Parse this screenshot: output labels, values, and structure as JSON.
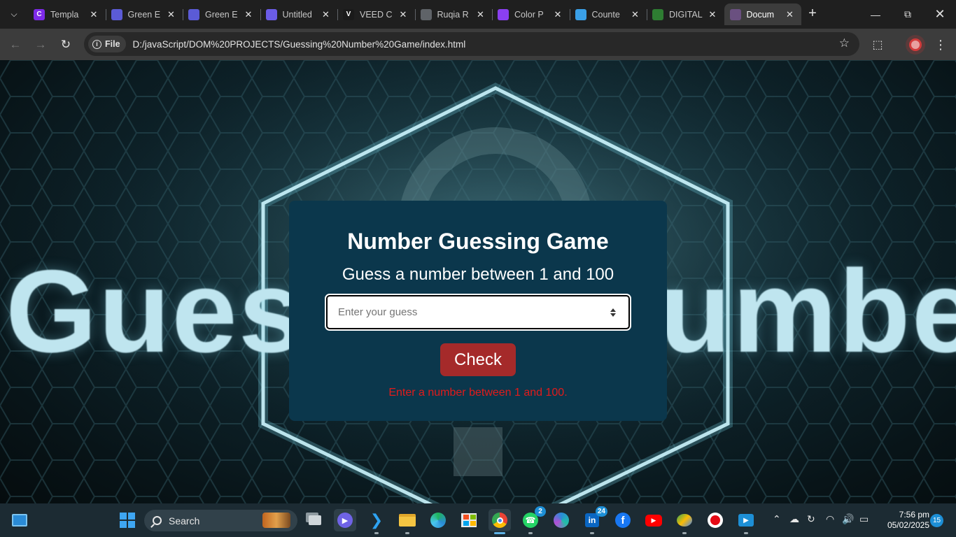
{
  "browser": {
    "tabs": [
      {
        "title": "Templa",
        "icon": "canva-icon",
        "color": "#7d2ae8",
        "glyph": "C",
        "active": false
      },
      {
        "title": "Green E",
        "icon": "doc-icon",
        "color": "#5b5bd6",
        "glyph": "",
        "active": false
      },
      {
        "title": "Green E",
        "icon": "doc-icon",
        "color": "#5b5bd6",
        "glyph": "",
        "active": false
      },
      {
        "title": "Untitled",
        "icon": "editor-icon",
        "color": "#6b5ce7",
        "glyph": "",
        "active": false
      },
      {
        "title": "VEED C",
        "icon": "veed-icon",
        "color": "#1a1a1a",
        "glyph": "V",
        "active": false
      },
      {
        "title": "Ruqia R",
        "icon": "globe-icon",
        "color": "#5f6368",
        "glyph": "",
        "active": false
      },
      {
        "title": "Color P",
        "icon": "color-icon",
        "color": "#8a3ff0",
        "glyph": "",
        "active": false
      },
      {
        "title": "Counte",
        "icon": "counter-icon",
        "color": "#3aa0e8",
        "glyph": "",
        "active": false
      },
      {
        "title": "DIGITAL",
        "icon": "digital-icon",
        "color": "#2e7d32",
        "glyph": "",
        "active": false
      },
      {
        "title": "Docum",
        "icon": "document-favicon-icon",
        "color": "#6a5080",
        "glyph": "",
        "active": true
      }
    ],
    "address": {
      "scheme_label": "File",
      "url": "D:/javaScript/DOM%20PROJECTS/Guessing%20Number%20Game/index.html"
    }
  },
  "page": {
    "background_text_left": "Gues",
    "background_text_right": "umbe",
    "title": "Number Guessing Game",
    "subtitle": "Guess a number between 1 and 100",
    "input": {
      "placeholder": "Enter your guess",
      "value": ""
    },
    "check_label": "Check",
    "message": "Enter a number between 1 and 100.",
    "colors": {
      "card": "#0b374c",
      "button": "#a52a2a",
      "message": "#e11b1b"
    }
  },
  "taskbar": {
    "search_label": "Search",
    "whatsapp_badge": "2",
    "linkedin_badge": "24",
    "time": "7:56 pm",
    "date": "05/02/2025",
    "notifications": "15"
  }
}
